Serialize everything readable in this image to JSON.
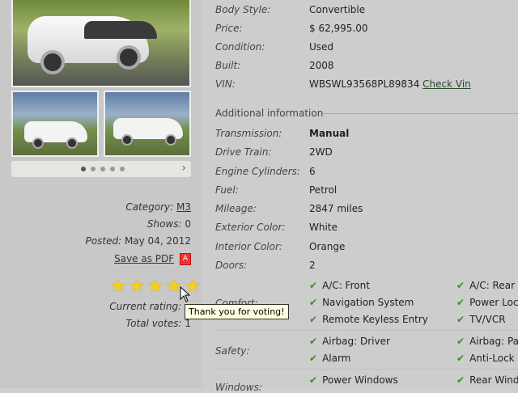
{
  "meta": {
    "category_label": "Category:",
    "category_value": "M3",
    "shows_label": "Shows:",
    "shows_value": "0",
    "posted_label": "Posted:",
    "posted_value": "May 04, 2012",
    "save_pdf": "Save as PDF",
    "pdf_icon_text": "A",
    "current_rating_label": "Current rating:",
    "total_votes_label": "Total votes:",
    "total_votes_value": "1",
    "tooltip": "Thank you for voting!",
    "stars_filled": 5,
    "pager_active_index": 0,
    "pager_next_icon": "chevron-right-icon"
  },
  "specs": [
    {
      "label": "Body Style:",
      "value": "Convertible"
    },
    {
      "label": "Price:",
      "value": "$ 62,995.00"
    },
    {
      "label": "Condition:",
      "value": "Used"
    },
    {
      "label": "Built:",
      "value": "2008"
    },
    {
      "label": "VIN:",
      "value": "WBSWL93568PL89834",
      "link": "Check Vin"
    }
  ],
  "additional_title": "Additional information",
  "additional": [
    {
      "label": "Transmission:",
      "value": "Manual"
    },
    {
      "label": "Drive Train:",
      "value": "2WD"
    },
    {
      "label": "Engine Cylinders:",
      "value": "6"
    },
    {
      "label": "Fuel:",
      "value": "Petrol"
    },
    {
      "label": "Mileage:",
      "value": "2847 miles"
    },
    {
      "label": "Exterior Color:",
      "value": "White"
    },
    {
      "label": "Interior Color:",
      "value": "Orange"
    },
    {
      "label": "Doors:",
      "value": "2"
    }
  ],
  "features": {
    "comfort_label": "Comfort:",
    "comfort": [
      "A/C: Front",
      "A/C: Rear",
      "Navigation System",
      "Power Lock",
      "Remote Keyless Entry",
      "TV/VCR"
    ],
    "safety_label": "Safety:",
    "safety": [
      "Airbag: Driver",
      "Airbag: Pa",
      "Alarm",
      "Anti-Lock B"
    ],
    "windows_label": "Windows:",
    "windows": [
      "Power Windows",
      "Rear Wind"
    ]
  },
  "colors": {
    "check": "#3a8a2a",
    "star": "#f4d21c",
    "tooltip_bg": "#ffffe1"
  }
}
